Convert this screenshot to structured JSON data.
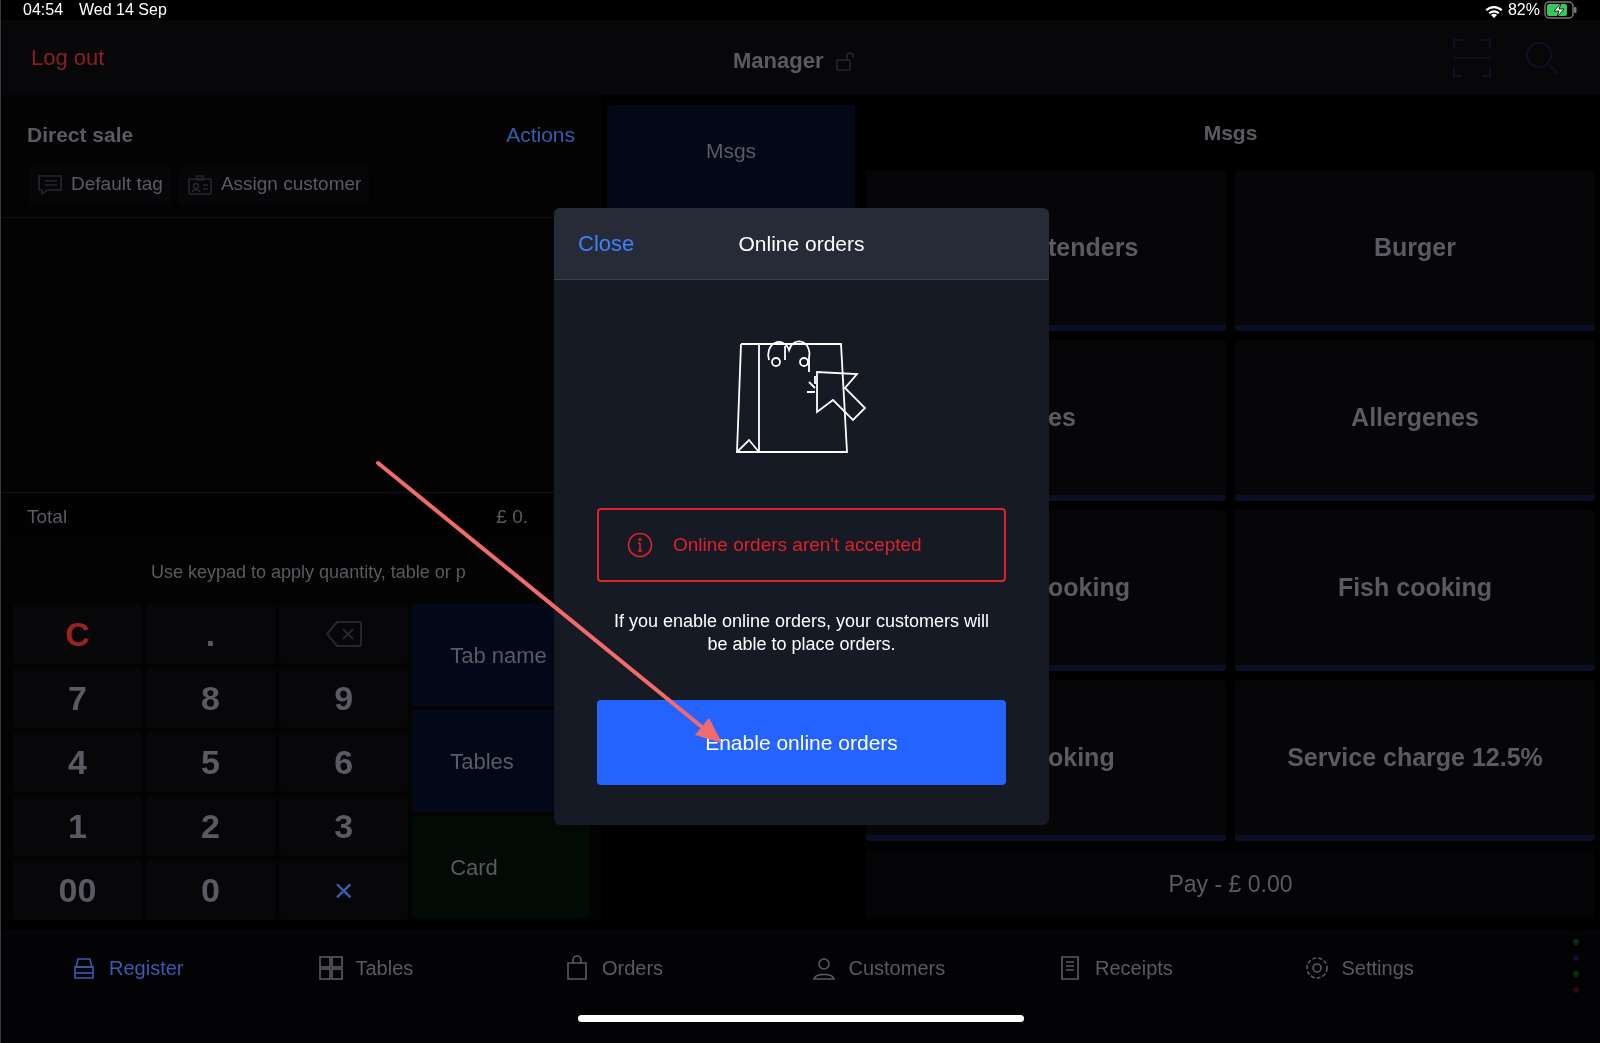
{
  "status_bar": {
    "time": "04:54",
    "date": "Wed 14 Sep",
    "battery": "82%"
  },
  "header": {
    "logout": "Log out",
    "title": "Manager"
  },
  "order": {
    "title": "Direct sale",
    "actions": "Actions",
    "tags": [
      {
        "label": "Default tag",
        "kind": "tag"
      },
      {
        "label": "Assign customer",
        "kind": "customer"
      }
    ],
    "total_label": "Total",
    "total_value": "£ 0.",
    "hint": "Use keypad to apply quantity, table or p"
  },
  "keypad": [
    {
      "label": "C",
      "kind": "clear"
    },
    {
      "label": ".",
      "kind": "digit"
    },
    {
      "kind": "backspace"
    },
    {
      "label": "7",
      "kind": "digit"
    },
    {
      "label": "8",
      "kind": "digit"
    },
    {
      "label": "9",
      "kind": "digit"
    },
    {
      "label": "4",
      "kind": "digit"
    },
    {
      "label": "5",
      "kind": "digit"
    },
    {
      "label": "6",
      "kind": "digit"
    },
    {
      "label": "1",
      "kind": "digit"
    },
    {
      "label": "2",
      "kind": "digit"
    },
    {
      "label": "3",
      "kind": "digit"
    },
    {
      "label": "00",
      "kind": "digit"
    },
    {
      "label": "0",
      "kind": "digit"
    },
    {
      "label": "×",
      "kind": "multiply"
    }
  ],
  "action_buttons": [
    {
      "label": "Tab name",
      "kind": "tab"
    },
    {
      "label": "Tables",
      "kind": "tables"
    },
    {
      "label": "Card",
      "kind": "card"
    }
  ],
  "category_tile": "Msgs",
  "products": {
    "title": "Msgs",
    "tiles": [
      "tenders",
      "Burger",
      "es",
      "Allergenes",
      "ooking",
      "Fish cooking",
      "oking",
      "Service charge 12.5%"
    ],
    "pay": "Pay - £ 0.00"
  },
  "tab_bar": [
    {
      "label": "Register",
      "kind": "register",
      "selected": true
    },
    {
      "label": "Tables",
      "kind": "tables",
      "selected": false
    },
    {
      "label": "Orders",
      "kind": "orders",
      "selected": false
    },
    {
      "label": "Customers",
      "kind": "customers",
      "selected": false
    },
    {
      "label": "Receipts",
      "kind": "receipts",
      "selected": false
    },
    {
      "label": "Settings",
      "kind": "settings",
      "selected": false
    }
  ],
  "modal": {
    "close": "Close",
    "title": "Online orders",
    "alert": "Online orders aren't accepted",
    "description": "If you enable online orders, your customers will be able to place orders.",
    "button": "Enable online orders"
  }
}
